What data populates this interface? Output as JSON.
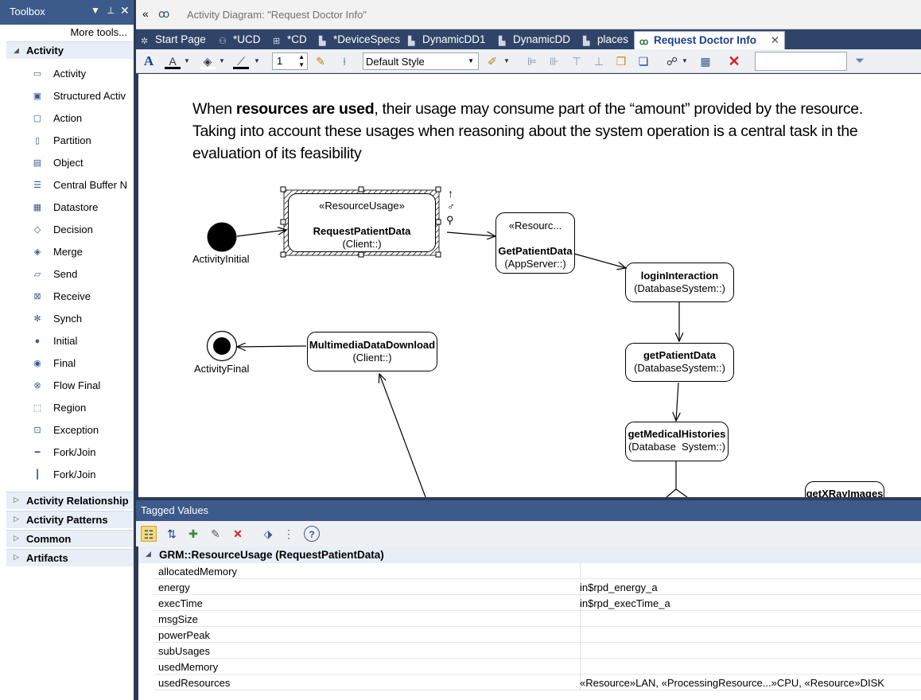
{
  "toolbox": {
    "title": "Toolbox",
    "more_tools": "More tools...",
    "active_section": "Activity",
    "items": [
      {
        "label": "Activity",
        "icon": "activity-icon"
      },
      {
        "label": "Structured Activ",
        "icon": "structured-activity-icon"
      },
      {
        "label": "Action",
        "icon": "action-icon"
      },
      {
        "label": "Partition",
        "icon": "partition-icon"
      },
      {
        "label": "Object",
        "icon": "object-icon"
      },
      {
        "label": "Central Buffer N",
        "icon": "central-buffer-icon"
      },
      {
        "label": "Datastore",
        "icon": "datastore-icon"
      },
      {
        "label": "Decision",
        "icon": "decision-icon"
      },
      {
        "label": "Merge",
        "icon": "merge-icon"
      },
      {
        "label": "Send",
        "icon": "send-icon"
      },
      {
        "label": "Receive",
        "icon": "receive-icon"
      },
      {
        "label": "Synch",
        "icon": "synch-icon"
      },
      {
        "label": "Initial",
        "icon": "initial-icon"
      },
      {
        "label": "Final",
        "icon": "final-icon"
      },
      {
        "label": "Flow Final",
        "icon": "flow-final-icon"
      },
      {
        "label": "Region",
        "icon": "region-icon"
      },
      {
        "label": "Exception",
        "icon": "exception-icon"
      },
      {
        "label": "Fork/Join",
        "icon": "fork-join-horizontal-icon"
      },
      {
        "label": "Fork/Join",
        "icon": "fork-join-vertical-icon"
      }
    ],
    "collapsed_sections": [
      "Activity Relationship",
      "Activity Patterns",
      "Common",
      "Artifacts"
    ]
  },
  "window": {
    "title": "Activity Diagram: \"Request Doctor Info\""
  },
  "tabs": [
    {
      "label": "Start Page",
      "active": false
    },
    {
      "label": "*UCD",
      "active": false
    },
    {
      "label": "*CD",
      "active": false
    },
    {
      "label": "*DeviceSpecs",
      "active": false
    },
    {
      "label": "DynamicDD1",
      "active": false
    },
    {
      "label": "DynamicDD",
      "active": false
    },
    {
      "label": "places",
      "active": false
    },
    {
      "label": "Request Doctor Info",
      "active": true
    }
  ],
  "toolbar": {
    "line_width": "1",
    "style": "Default Style",
    "search_value": ""
  },
  "diagram": {
    "note_pre": "When ",
    "note_bold": "resources are used",
    "note_post": ", their usage may consume part of the “amount” provided by the resource. Taking into account these usages when reasoning about the system operation is a central task in the evaluation of its feasibility",
    "initial_label": "ActivityInitial",
    "final_label": "ActivityFinal",
    "nodes": {
      "request": {
        "stereotype": "«ResourceUsage»",
        "name": "RequestPatientData",
        "owner": "(Client::)"
      },
      "getpatient": {
        "stereotype": "«Resourc...",
        "name": "GetPatientData",
        "owner": "(AppServer::)"
      },
      "login": {
        "name": "loginInteraction",
        "owner": "(DatabaseSystem::)"
      },
      "getpatientdb": {
        "name": "getPatientData",
        "owner": "(DatabaseSystem::)"
      },
      "histories": {
        "name": "getMedicalHistories",
        "owner": "(Database  System::)"
      },
      "multimedia": {
        "name": "MultimediaDataDownload",
        "owner": "(Client::)"
      },
      "xray": {
        "name": "getXRayImages"
      }
    }
  },
  "tagged_values": {
    "title": "Tagged Values",
    "group": "GRM::ResourceUsage (RequestPatientData)",
    "rows": [
      {
        "key": "allocatedMemory",
        "value": ""
      },
      {
        "key": "energy",
        "value": "in$rpd_energy_a"
      },
      {
        "key": "execTime",
        "value": "in$rpd_execTime_a"
      },
      {
        "key": "msgSize",
        "value": ""
      },
      {
        "key": "powerPeak",
        "value": ""
      },
      {
        "key": "subUsages",
        "value": ""
      },
      {
        "key": "usedMemory",
        "value": ""
      },
      {
        "key": "usedResources",
        "value": "«Resource»LAN, «ProcessingResource...»CPU, «Resource»DISK"
      }
    ]
  }
}
